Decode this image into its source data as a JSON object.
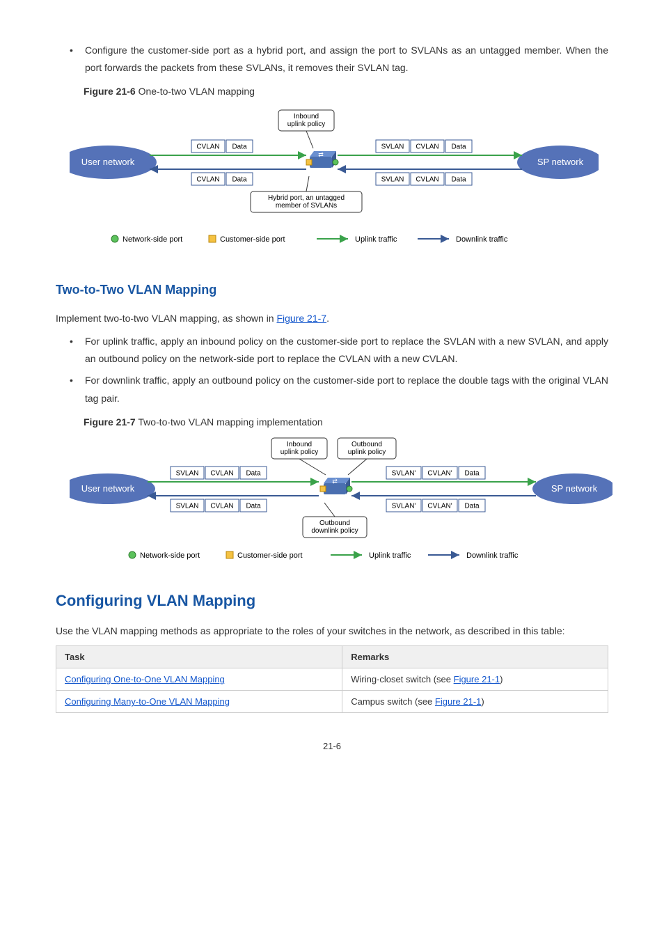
{
  "bullet1": "Configure the customer-side port as a hybrid port, and assign the port to SVLANs as an untagged member. When the port forwards the packets from these SVLANs, it removes their SVLAN tag.",
  "fig6": {
    "label": "Figure 21-6",
    "title": "One-to-two VLAN mapping",
    "inbound": "Inbound\nuplink policy",
    "cvlan": "CVLAN",
    "svlan": "SVLAN",
    "data": "Data",
    "user_net": "User network",
    "sp_net": "SP network",
    "hybrid": "Hybrid port, an untagged\nmember of SVLANs",
    "legend_net": "Network-side port",
    "legend_cust": "Customer-side port",
    "legend_up": "Uplink traffic",
    "legend_down": "Downlink traffic"
  },
  "sec_two_heading": "Two-to-Two VLAN Mapping",
  "para_two_a": "Implement two-to-two VLAN mapping, as shown in ",
  "para_two_link": "Figure 21-7",
  "para_two_b": ".",
  "bullet2_1": "For uplink traffic, apply an inbound policy on the customer-side port to replace the SVLAN with a new SVLAN, and apply an outbound policy on the network-side port to replace the CVLAN with a new CVLAN.",
  "bullet2_2": "For downlink traffic, apply an outbound policy on the customer-side port to replace the double tags with the original VLAN tag pair.",
  "fig7": {
    "label": "Figure 21-7",
    "title": "Two-to-two VLAN mapping implementation",
    "inbound": "Inbound\nuplink policy",
    "outbound_up": "Outbound\nuplink policy",
    "outbound_down": "Outbound\ndownlink policy",
    "svlan": "SVLAN",
    "cvlan": "CVLAN",
    "svlanp": "SVLAN'",
    "cvlanp": "CVLAN'",
    "data": "Data",
    "user_net": "User network",
    "sp_net": "SP network",
    "legend_net": "Network-side port",
    "legend_cust": "Customer-side port",
    "legend_up": "Uplink traffic",
    "legend_down": "Downlink traffic"
  },
  "sec_cfg_heading": "Configuring VLAN Mapping",
  "cfg_para": "Use the VLAN mapping methods as appropriate to the roles of your switches in the network, as described in this table:",
  "table": {
    "head_task": "Task",
    "head_remarks": "Remarks",
    "row1_task": "Configuring One-to-One VLAN Mapping",
    "row1_rem_a": "Wiring-closet switch (see ",
    "row1_rem_link": "Figure 21-1",
    "row1_rem_b": ")",
    "row2_task": "Configuring Many-to-One VLAN Mapping",
    "row2_rem_a": "Campus switch (see ",
    "row2_rem_link": "Figure 21-1",
    "row2_rem_b": ")"
  },
  "page": "21-6"
}
